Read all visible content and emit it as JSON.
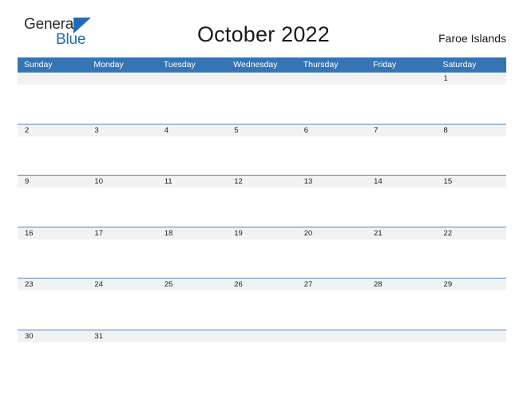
{
  "brand": {
    "name_part1": "General",
    "name_part2": "Blue",
    "triangle_color": "#1f6cb4",
    "text_color": "#2b2b2b"
  },
  "header": {
    "month_title": "October 2022",
    "locale": "Faroe Islands"
  },
  "theme": {
    "header_blue": "#3575b5",
    "rule_blue": "#4a86c8",
    "band_gray": "#f2f2f2",
    "text_dark": "#1a1a1a"
  },
  "calendar": {
    "weekdays": [
      "Sunday",
      "Monday",
      "Tuesday",
      "Wednesday",
      "Thursday",
      "Friday",
      "Saturday"
    ],
    "weeks": [
      [
        "",
        "",
        "",
        "",
        "",
        "",
        "1"
      ],
      [
        "2",
        "3",
        "4",
        "5",
        "6",
        "7",
        "8"
      ],
      [
        "9",
        "10",
        "11",
        "12",
        "13",
        "14",
        "15"
      ],
      [
        "16",
        "17",
        "18",
        "19",
        "20",
        "21",
        "22"
      ],
      [
        "23",
        "24",
        "25",
        "26",
        "27",
        "28",
        "29"
      ],
      [
        "30",
        "31",
        "",
        "",
        "",
        "",
        ""
      ]
    ]
  }
}
